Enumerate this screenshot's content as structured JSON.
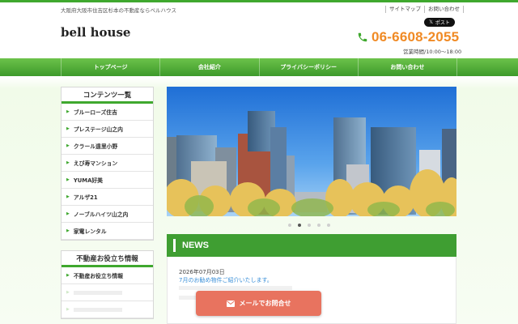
{
  "header": {
    "tagline": "大阪府大阪市住吉区杉本の不動産ならベルハウス",
    "toplinks": [
      "サイトマップ",
      "お問い合わせ"
    ],
    "share_label": "ポスト",
    "logo": "bell house",
    "phone": "06-6608-2055",
    "hours": "営業時間/10:00〜18:00"
  },
  "nav": [
    "トップページ",
    "会社紹介",
    "プライバシーポリシー",
    "お問い合わせ"
  ],
  "sidebar": {
    "contents_title": "コンテンツ一覧",
    "contents_items": [
      "ブルーローズ住吉",
      "プレステージ山之内",
      "クラール遠里小野",
      "えび寿マンション",
      "YUMA好美",
      "アルザ21",
      "ノーブルハイツ山之内",
      "家電レンタル"
    ],
    "info_title": "不動産お役立ち情報",
    "info_items": [
      "不動産お役立ち情報",
      "",
      ""
    ]
  },
  "slider": {
    "total": 5,
    "active": 2
  },
  "news": {
    "title": "NEWS",
    "date": "2026年07月03日",
    "item": "7月のお勧め物件ご紹介いたします。"
  },
  "cta": {
    "label": "メールでお問合せ"
  },
  "colors": {
    "green": "#3fa82e",
    "orange": "#f08a24",
    "cta": "#e8735f"
  }
}
